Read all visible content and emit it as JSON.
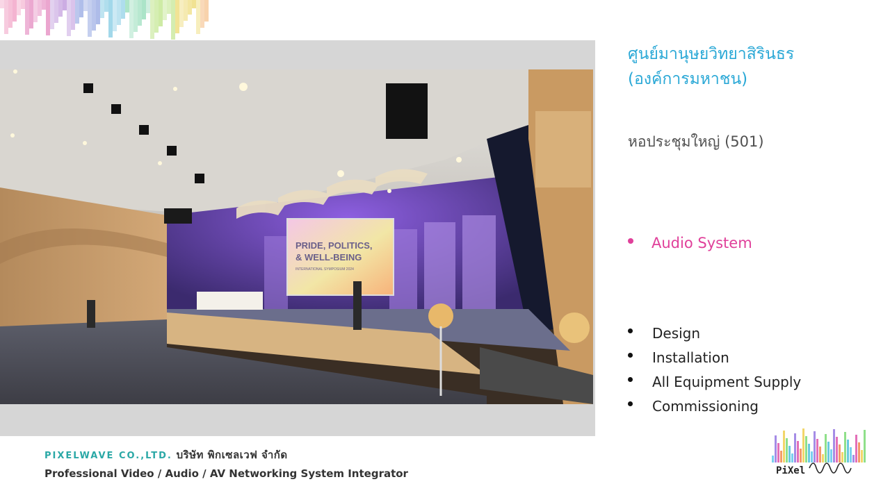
{
  "header": {
    "decor": "pixel-art-strip"
  },
  "photo": {
    "screen": {
      "line1": "PRIDE, POLITICS,",
      "line2": "& WELL-BEING",
      "line3": "INTERNATIONAL SYMPOSIUM 2024"
    }
  },
  "panel": {
    "title_line1": "ศูนย์มานุษยวิทยาสิรินธร",
    "title_line2": "(องค์การมหาชน)",
    "subtitle": "หอประชุมใหญ่ (501)",
    "highlight": "Audio System",
    "services": [
      "Design",
      "Installation",
      "All Equipment Supply",
      "Commissioning"
    ]
  },
  "footer": {
    "company_en": "PIXELWAVE CO.,LTD.",
    "company_th": "บริษัท พิกเซลเวฟ จำกัด",
    "tagline": "Professional Video / Audio / AV Networking System Integrator"
  },
  "logo": {
    "text": "PiXel"
  },
  "colors": {
    "title": "#2aa8d6",
    "highlight": "#e0409a",
    "band": "#d6d6d6"
  }
}
